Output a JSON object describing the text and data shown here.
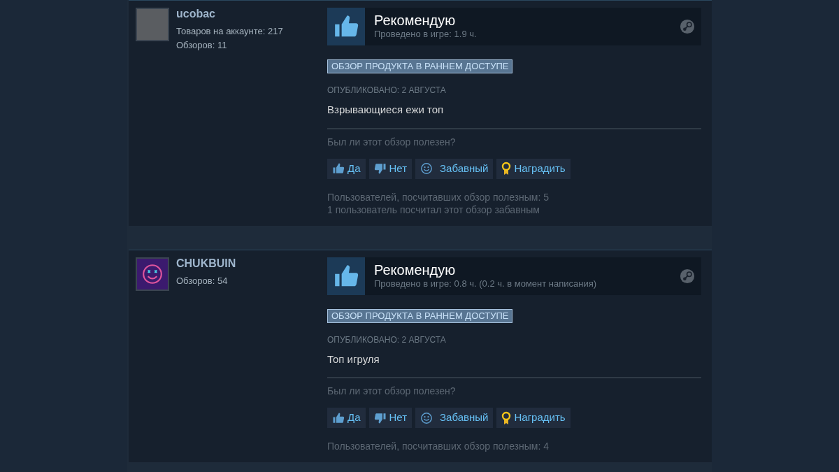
{
  "reviews": [
    {
      "author": "ucobac",
      "avatar": {
        "kind": "photo"
      },
      "stats": [
        "Товаров на аккаунте: 217",
        "Обзоров: 11"
      ],
      "verdict": "Рекомендую",
      "playtime": "Проведено в игре: 1.9 ч.",
      "badge": "ОБЗОР ПРОДУКТА В РАННЕМ ДОСТУПЕ",
      "posted": "ОПУБЛИКОВАНО: 2 АВГУСТА",
      "text": "Взрывающиеся ежи топ",
      "question": "Был ли этот обзор полезен?",
      "buttons": [
        {
          "kind": "yes",
          "label": "Да"
        },
        {
          "kind": "no",
          "label": "Нет"
        },
        {
          "kind": "funny",
          "label": "Забавный"
        },
        {
          "kind": "award",
          "label": "Наградить"
        }
      ],
      "summary": [
        "Пользователей, посчитавших обзор полезным: 5",
        "1 пользователь посчитал этот обзор забавным"
      ]
    },
    {
      "author": "CHUKBUIN",
      "avatar": {
        "kind": "artwork"
      },
      "stats": [
        "Обзоров: 54"
      ],
      "verdict": "Рекомендую",
      "playtime": "Проведено в игре: 0.8 ч. (0.2 ч. в момент написания)",
      "badge": "ОБЗОР ПРОДУКТА В РАННЕМ ДОСТУПЕ",
      "posted": "ОПУБЛИКОВАНО: 2 АВГУСТА",
      "text": "Топ игруля",
      "question": "Был ли этот обзор полезен?",
      "buttons": [
        {
          "kind": "yes",
          "label": "Да"
        },
        {
          "kind": "no",
          "label": "Нет"
        },
        {
          "kind": "funny",
          "label": "Забавный"
        },
        {
          "kind": "award",
          "label": "Наградить"
        }
      ],
      "summary": [
        "Пользователей, посчитавших обзор полезным: 4"
      ]
    }
  ]
}
